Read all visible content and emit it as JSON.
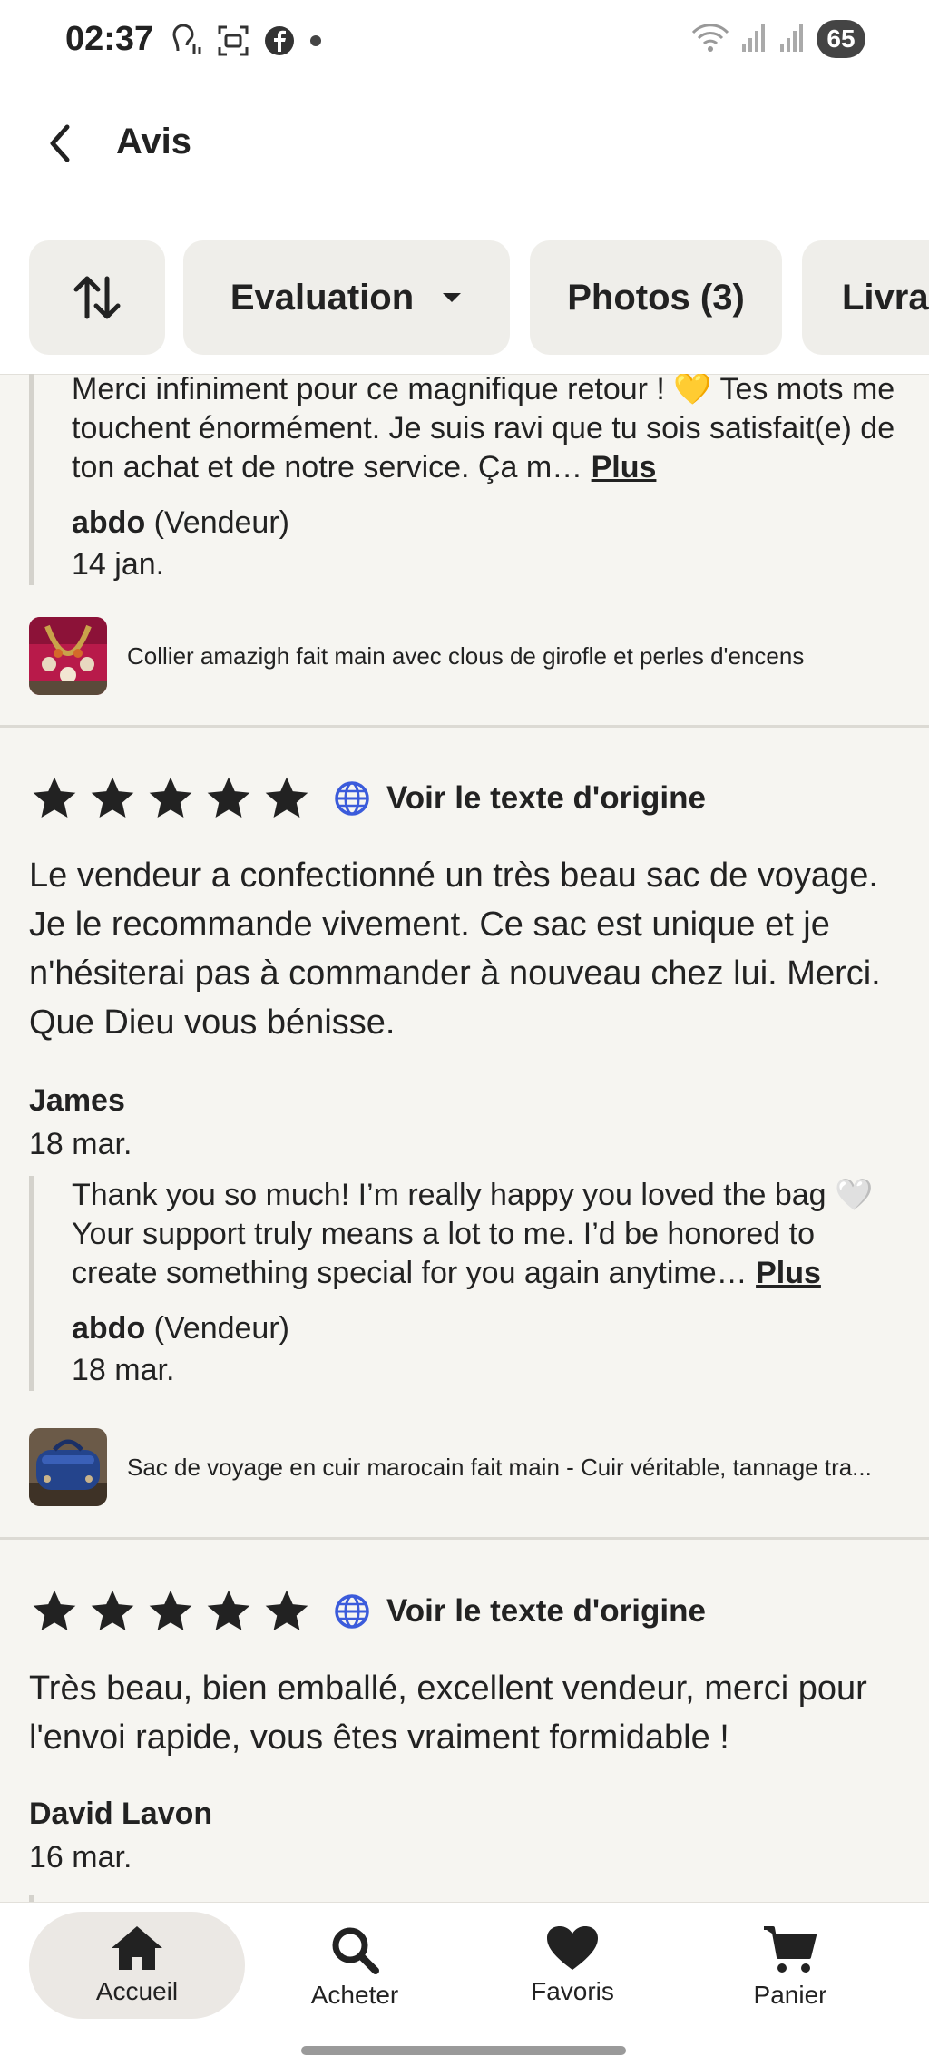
{
  "status": {
    "time": "02:37",
    "battery": "65",
    "icons_left": [
      "hearing-aid-icon",
      "screenshot-icon",
      "facebook-icon",
      "dot-icon"
    ],
    "icons_right": [
      "wifi-icon",
      "signal-icon",
      "signal-icon-2"
    ]
  },
  "header": {
    "title": "Avis"
  },
  "filters": {
    "evaluation": "Evaluation",
    "photos": "Photos (3)",
    "livraison": "Livrai"
  },
  "reviews": [
    {
      "reply": {
        "text": "Merci infiniment pour ce magnifique retour ! 💛 Tes mots me touchent énormément. Je suis ravi que tu sois satisfait(e) de ton achat et de notre service. Ça m…",
        "more": "Plus",
        "author": "abdo",
        "role": "(Vendeur)",
        "date": "14 jan."
      },
      "product": "Collier amazigh fait main avec clous de girofle et perles d'encens"
    },
    {
      "rating": 5,
      "translate": "Voir le texte d'origine",
      "text": "Le vendeur a confectionné un très beau sac de voyage. Je le recommande vivement. Ce sac est unique et je n'hésiterai pas à commander à nouveau chez lui. Merci. Que Dieu vous bénisse.",
      "author": "James",
      "date": "18 mar.",
      "reply": {
        "text": "Thank you so much! I’m really happy you loved the bag 🤍 Your support truly means a lot to me. I’d be honored to create something special for you again anytime…",
        "more": "Plus",
        "author": "abdo",
        "role": "(Vendeur)",
        "date": "18 mar."
      },
      "product": "Sac de voyage en cuir marocain fait main - Cuir véritable, tannage tra..."
    },
    {
      "rating": 5,
      "translate": "Voir le texte d'origine",
      "text": "Très beau, bien emballé, excellent vendeur, merci pour l'envoi rapide, vous êtes vraiment formidable !",
      "author": "David Lavon",
      "date": "16 mar."
    }
  ],
  "nav": {
    "home": "Accueil",
    "shop": "Acheter",
    "favorites": "Favoris",
    "cart": "Panier"
  },
  "colors": {
    "accent_active": "#ebe8e4",
    "star": "#222222",
    "globe": "#3b5bdb"
  }
}
